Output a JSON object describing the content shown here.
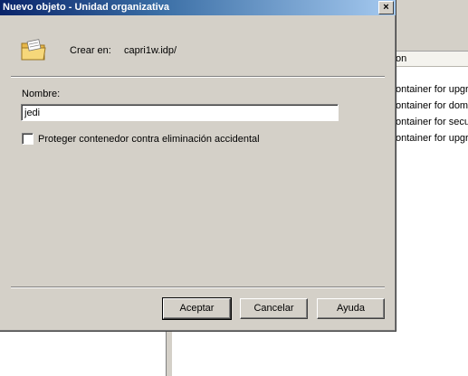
{
  "dialog": {
    "title": "Nuevo objeto - Unidad organizativa",
    "close_label": "×",
    "crear_en_label": "Crear en:",
    "crear_en_value": "capri1w.idp/",
    "nombre_label": "Nombre:",
    "nombre_value": "jedi",
    "protect_label": "Proteger contenedor contra eliminación accidental",
    "protect_checked": false,
    "buttons": {
      "ok": "Aceptar",
      "cancel": "Cancelar",
      "help": "Ayuda"
    }
  },
  "background": {
    "column_header": "on",
    "rows": [
      "ontainer for upgr",
      "ontainer for dom",
      "ontainer for secu",
      "ontainer for upgr"
    ]
  }
}
